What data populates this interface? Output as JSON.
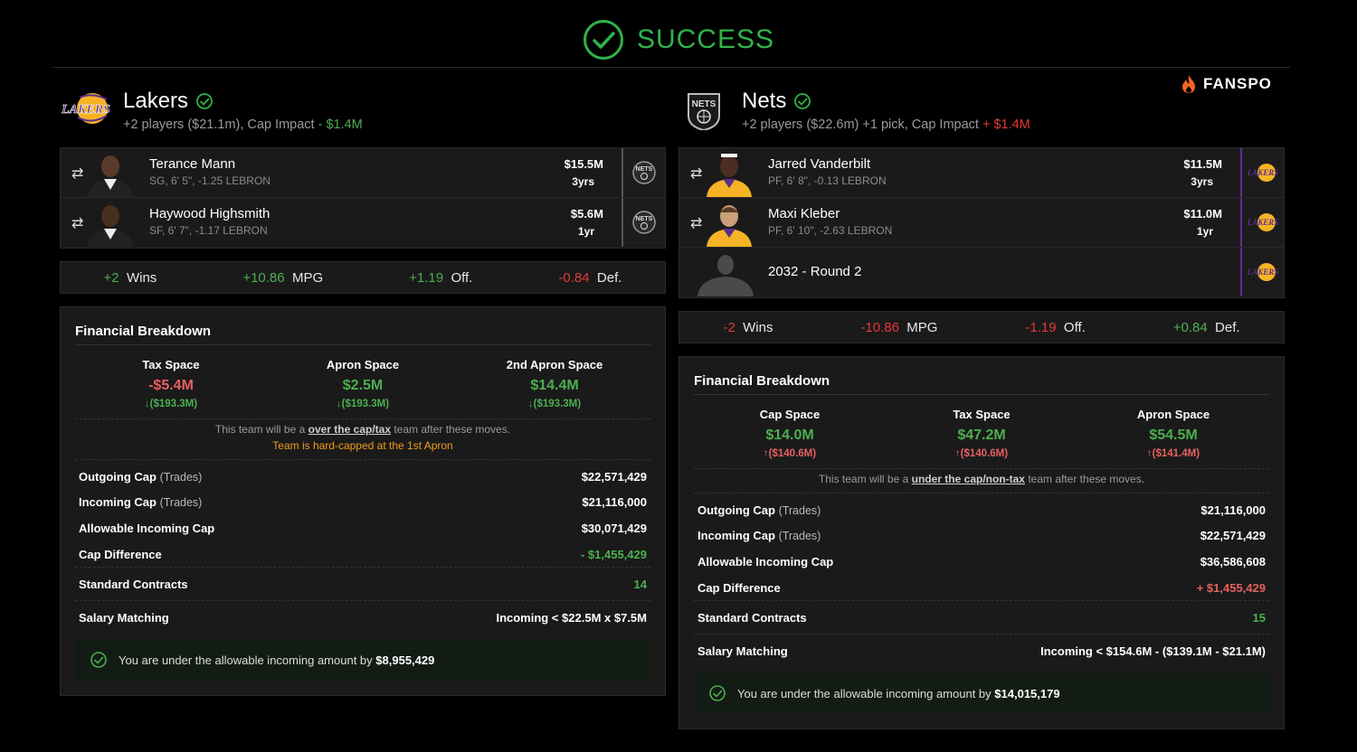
{
  "header": {
    "title": "SUCCESS"
  },
  "brand": {
    "name": "FANSPO"
  },
  "lakers": {
    "name": "Lakers",
    "summary": "+2 players ($21.1m), Cap Impact",
    "cap_impact": "- $1.4M",
    "players": [
      {
        "name": "Terance Mann",
        "meta": "SG, 6' 5\", -1.25 LEBRON",
        "salary": "$15.5M",
        "years": "3yrs",
        "destination": "nets-logo"
      },
      {
        "name": "Haywood Highsmith",
        "meta": "SF, 6' 7\", -1.17 LEBRON",
        "salary": "$5.6M",
        "years": "1yr",
        "destination": "nets-logo"
      }
    ],
    "stats": {
      "wins_val": "+2",
      "wins_lbl": "Wins",
      "mpg_val": "+10.86",
      "mpg_lbl": "MPG",
      "off_val": "+1.19",
      "off_lbl": "Off.",
      "def_val": "-0.84",
      "def_lbl": "Def."
    },
    "financial": {
      "title": "Financial Breakdown",
      "spaces": [
        {
          "label": "Tax Space",
          "value": "-$5.4M",
          "sub": "($193.3M)"
        },
        {
          "label": "Apron Space",
          "value": "$2.5M",
          "sub": "($193.3M)"
        },
        {
          "label": "2nd Apron Space",
          "value": "$14.4M",
          "sub": "($193.3M)"
        }
      ],
      "note_pre": "This team will be a",
      "note_link": "over the cap/tax",
      "note_post": "team after these moves.",
      "note_warning": "Team is hard-capped at the 1st Apron",
      "rows": [
        {
          "label": "Outgoing Cap",
          "paren": "(Trades)",
          "value": "$22,571,429"
        },
        {
          "label": "Incoming Cap",
          "paren": "(Trades)",
          "value": "$21,116,000"
        },
        {
          "label": "Allowable Incoming Cap",
          "paren": "",
          "value": "$30,071,429"
        },
        {
          "label": "Cap Difference",
          "paren": "",
          "value": "- $1,455,429"
        }
      ],
      "contracts_label": "Standard Contracts",
      "contracts_value": "14",
      "matching_label": "Salary Matching",
      "matching_value": "Incoming < $22.5M x $7.5M",
      "banner_text": "You are under the allowable incoming amount by",
      "banner_amount": "$8,955,429"
    }
  },
  "nets": {
    "name": "Nets",
    "summary": "+2 players ($22.6m) +1 pick, Cap Impact",
    "cap_impact": "+ $1.4M",
    "players": [
      {
        "name": "Jarred Vanderbilt",
        "meta": "PF, 6' 8\", -0.13 LEBRON",
        "salary": "$11.5M",
        "years": "3yrs",
        "destination": "lakers-logo"
      },
      {
        "name": "Maxi Kleber",
        "meta": "PF, 6' 10\", -2.63 LEBRON",
        "salary": "$11.0M",
        "years": "1yr",
        "destination": "lakers-logo"
      }
    ],
    "pick": {
      "name": "2032 - Round 2",
      "destination": "lakers-logo"
    },
    "stats": {
      "wins_val": "-2",
      "wins_lbl": "Wins",
      "mpg_val": "-10.86",
      "mpg_lbl": "MPG",
      "off_val": "-1.19",
      "off_lbl": "Off.",
      "def_val": "+0.84",
      "def_lbl": "Def."
    },
    "financial": {
      "title": "Financial Breakdown",
      "spaces": [
        {
          "label": "Cap Space",
          "value": "$14.0M",
          "sub": "($140.6M)"
        },
        {
          "label": "Tax Space",
          "value": "$47.2M",
          "sub": "($140.6M)"
        },
        {
          "label": "Apron Space",
          "value": "$54.5M",
          "sub": "($141.4M)"
        }
      ],
      "note_pre": "This team will be a",
      "note_link": "under the cap/non-tax",
      "note_post": "team after these moves.",
      "rows": [
        {
          "label": "Outgoing Cap",
          "paren": "(Trades)",
          "value": "$21,116,000"
        },
        {
          "label": "Incoming Cap",
          "paren": "(Trades)",
          "value": "$22,571,429"
        },
        {
          "label": "Allowable Incoming Cap",
          "paren": "",
          "value": "$36,586,608"
        },
        {
          "label": "Cap Difference",
          "paren": "",
          "value": "+ $1,455,429"
        }
      ],
      "contracts_label": "Standard Contracts",
      "contracts_value": "15",
      "matching_label": "Salary Matching",
      "matching_value": "Incoming < $154.6M - ($139.1M - $21.1M)",
      "banner_text": "You are under the allowable incoming amount by",
      "banner_amount": "$14,015,179"
    }
  },
  "colors": {
    "success": "#2fb34a",
    "negative": "#e53935",
    "warning": "#f29b1d",
    "lakers_purple": "#5b2d8e",
    "lakers_gold": "#f5b325"
  }
}
